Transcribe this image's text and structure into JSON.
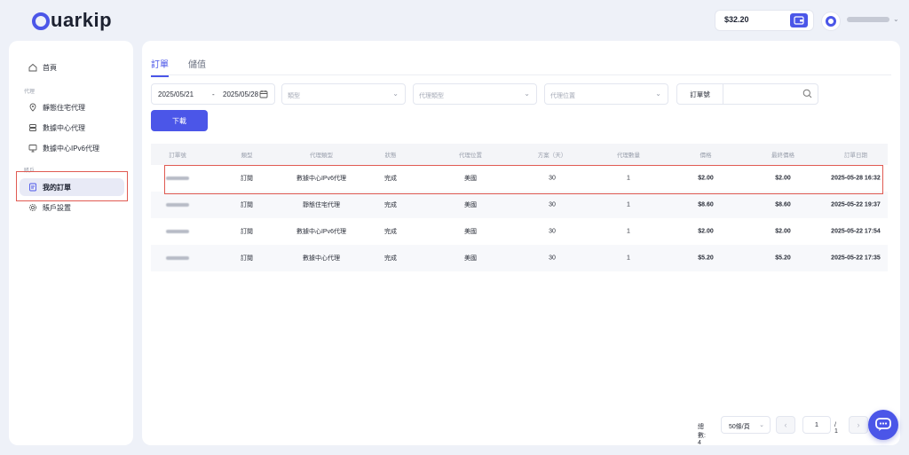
{
  "app": {
    "logo_text": "uarkip",
    "brand_color": "#4b56e8"
  },
  "header": {
    "balance": "$32.20"
  },
  "sidebar": {
    "home": "首頁",
    "group_proxy": "代理",
    "items": [
      {
        "label": "靜態住宅代理",
        "icon": "location-pin-icon"
      },
      {
        "label": "數據中心代理",
        "icon": "database-icon"
      },
      {
        "label": "數據中心IPv6代理",
        "icon": "monitor-icon"
      }
    ],
    "group_account": "賬戶",
    "my_orders": "我的訂單",
    "account_settings": "賬戶設置"
  },
  "tabs": [
    {
      "label": "訂單",
      "active": true
    },
    {
      "label": "儲值",
      "active": false
    }
  ],
  "filters": {
    "date_start": "2025/05/21",
    "date_sep": "-",
    "date_end": "2025/05/28",
    "type_placeholder": "類型",
    "proxy_type_placeholder": "代理類型",
    "proxy_location_placeholder": "代理位置",
    "order_no_label": "訂單號",
    "order_no_value": ""
  },
  "download_label": "下載",
  "table": {
    "columns": [
      "訂單號",
      "類型",
      "代理類型",
      "狀態",
      "代理位置",
      "方案（天）",
      "代理數量",
      "價格",
      "最終價格",
      "訂單日期"
    ],
    "rows": [
      [
        "",
        "訂閱",
        "數據中心IPv6代理",
        "完成",
        "美國",
        "30",
        "1",
        "$2.00",
        "$2.00",
        "2025-05-28 16:32"
      ],
      [
        "",
        "訂閱",
        "靜態住宅代理",
        "完成",
        "美國",
        "30",
        "1",
        "$8.60",
        "$8.60",
        "2025-05-22 19:37"
      ],
      [
        "",
        "訂閱",
        "數據中心IPv6代理",
        "完成",
        "美國",
        "30",
        "1",
        "$2.00",
        "$2.00",
        "2025-05-22 17:54"
      ],
      [
        "",
        "訂閱",
        "數據中心代理",
        "完成",
        "美國",
        "30",
        "1",
        "$5.20",
        "$5.20",
        "2025-05-22 17:35"
      ]
    ]
  },
  "pagination": {
    "total": "總數: 4",
    "page_size": "50條/頁",
    "prev": "‹",
    "current_page": "1",
    "of": "/ 1",
    "next": "›"
  }
}
